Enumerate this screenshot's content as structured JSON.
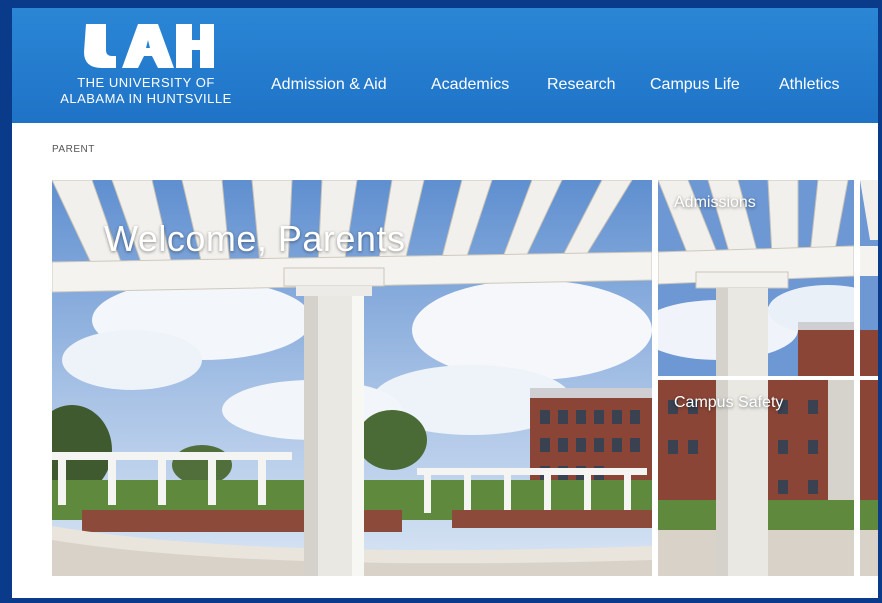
{
  "header": {
    "logo_text_line1": "THE UNIVERSITY OF",
    "logo_text_line2": "ALABAMA IN HUNTSVILLE",
    "logo_letters": "UAH",
    "nav": [
      {
        "label": "Admission & Aid"
      },
      {
        "label": "Academics"
      },
      {
        "label": "Research"
      },
      {
        "label": "Campus Life"
      },
      {
        "label": "Athletics"
      }
    ]
  },
  "breadcrumb": "PARENT",
  "hero": {
    "title": "Welcome, Parents"
  },
  "tiles": [
    {
      "label": "Admissions"
    },
    {
      "label": "Campus Safety"
    }
  ],
  "colors": {
    "header_blue": "#2b86d6",
    "frame_border": "#0a3a8a"
  }
}
